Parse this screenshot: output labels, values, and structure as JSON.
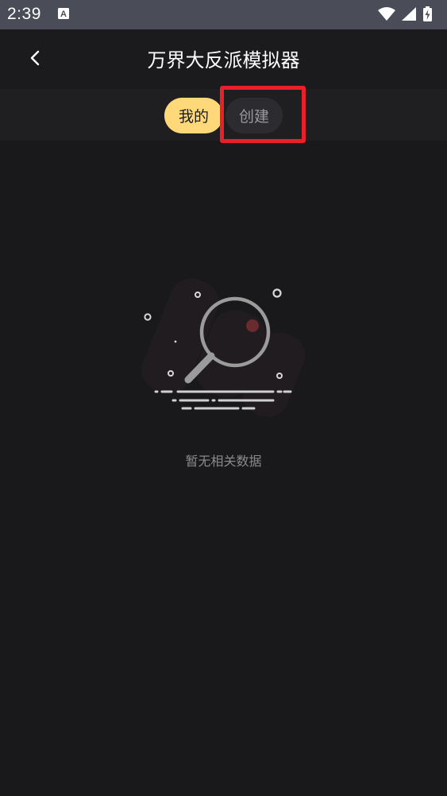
{
  "status_bar": {
    "time": "2:39",
    "notification_icon": "a-box-icon",
    "icons": [
      "wifi-icon",
      "signal-icon",
      "battery-charging-icon"
    ]
  },
  "header": {
    "title": "万界大反派模拟器",
    "back_icon": "chevron-left-icon"
  },
  "tabs": [
    {
      "label": "我的",
      "selected": true
    },
    {
      "label": "创建",
      "selected": false
    }
  ],
  "empty_state": {
    "icon": "magnifier-empty-icon",
    "message": "暂无相关数据"
  },
  "colors": {
    "status_bar_bg": "#4a4c58",
    "background": "#19191b",
    "tab_active_bg": "#ffd879",
    "tab_inactive_bg": "#2c2c30",
    "highlight": "#e8202a"
  }
}
